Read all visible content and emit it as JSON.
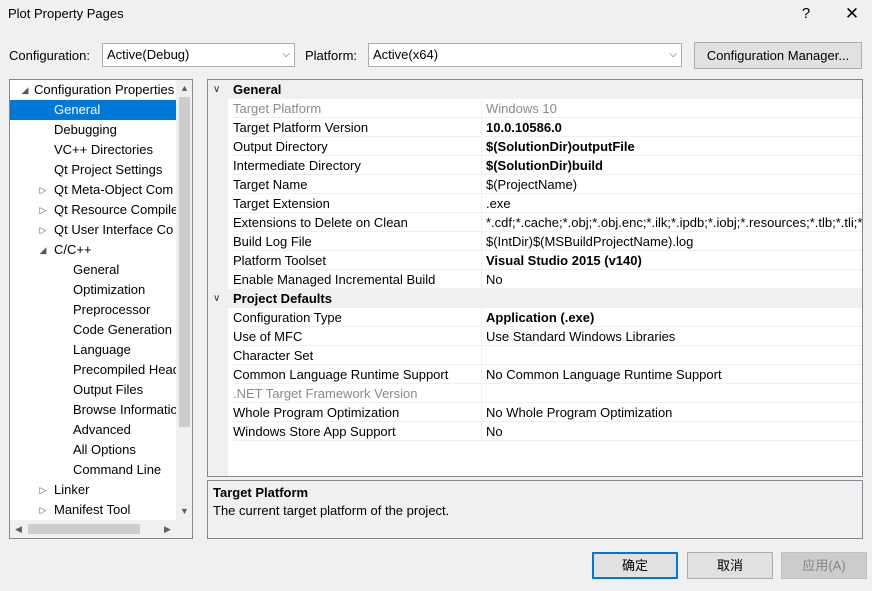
{
  "window": {
    "title": "Plot Property Pages",
    "help_glyph": "?",
    "close_glyph": "✕"
  },
  "toolbar": {
    "configuration_label": "Configuration:",
    "configuration_value": "Active(Debug)",
    "platform_label": "Platform:",
    "platform_value": "Active(x64)",
    "config_manager_label": "Configuration Manager..."
  },
  "tree": {
    "items": [
      {
        "label": "Configuration Properties",
        "level": 0,
        "expander": "expanded"
      },
      {
        "label": "General",
        "level": 1,
        "expander": "none",
        "selected": true
      },
      {
        "label": "Debugging",
        "level": 1,
        "expander": "none"
      },
      {
        "label": "VC++ Directories",
        "level": 1,
        "expander": "none"
      },
      {
        "label": "Qt Project Settings",
        "level": 1,
        "expander": "none"
      },
      {
        "label": "Qt Meta-Object Com",
        "level": 1,
        "expander": "collapsed"
      },
      {
        "label": "Qt Resource Compile",
        "level": 1,
        "expander": "collapsed"
      },
      {
        "label": "Qt User Interface Co",
        "level": 1,
        "expander": "collapsed"
      },
      {
        "label": "C/C++",
        "level": 1,
        "expander": "expanded"
      },
      {
        "label": "General",
        "level": 2,
        "expander": "none"
      },
      {
        "label": "Optimization",
        "level": 2,
        "expander": "none"
      },
      {
        "label": "Preprocessor",
        "level": 2,
        "expander": "none"
      },
      {
        "label": "Code Generation",
        "level": 2,
        "expander": "none"
      },
      {
        "label": "Language",
        "level": 2,
        "expander": "none"
      },
      {
        "label": "Precompiled Head",
        "level": 2,
        "expander": "none"
      },
      {
        "label": "Output Files",
        "level": 2,
        "expander": "none"
      },
      {
        "label": "Browse Informatio",
        "level": 2,
        "expander": "none"
      },
      {
        "label": "Advanced",
        "level": 2,
        "expander": "none"
      },
      {
        "label": "All Options",
        "level": 2,
        "expander": "none"
      },
      {
        "label": "Command Line",
        "level": 2,
        "expander": "none"
      },
      {
        "label": "Linker",
        "level": 1,
        "expander": "collapsed"
      },
      {
        "label": "Manifest Tool",
        "level": 1,
        "expander": "collapsed"
      }
    ]
  },
  "grid": {
    "categories": [
      {
        "name": "General",
        "rows": [
          {
            "name": "Target Platform",
            "value": "Windows 10",
            "bold": false,
            "dim": true
          },
          {
            "name": "Target Platform Version",
            "value": "10.0.10586.0",
            "bold": true,
            "dim": false
          },
          {
            "name": "Output Directory",
            "value": "$(SolutionDir)outputFile",
            "bold": true,
            "dim": false
          },
          {
            "name": "Intermediate Directory",
            "value": "$(SolutionDir)build",
            "bold": true,
            "dim": false
          },
          {
            "name": "Target Name",
            "value": "$(ProjectName)",
            "bold": false,
            "dim": false
          },
          {
            "name": "Target Extension",
            "value": ".exe",
            "bold": false,
            "dim": false
          },
          {
            "name": "Extensions to Delete on Clean",
            "value": "*.cdf;*.cache;*.obj;*.obj.enc;*.ilk;*.ipdb;*.iobj;*.resources;*.tlb;*.tli;*.t",
            "bold": false,
            "dim": false
          },
          {
            "name": "Build Log File",
            "value": "$(IntDir)$(MSBuildProjectName).log",
            "bold": false,
            "dim": false
          },
          {
            "name": "Platform Toolset",
            "value": "Visual Studio 2015 (v140)",
            "bold": true,
            "dim": false
          },
          {
            "name": "Enable Managed Incremental Build",
            "value": "No",
            "bold": false,
            "dim": false
          }
        ]
      },
      {
        "name": "Project Defaults",
        "rows": [
          {
            "name": "Configuration Type",
            "value": "Application (.exe)",
            "bold": true,
            "dim": false
          },
          {
            "name": "Use of MFC",
            "value": "Use Standard Windows Libraries",
            "bold": false,
            "dim": false
          },
          {
            "name": "Character Set",
            "value": "",
            "bold": false,
            "dim": false
          },
          {
            "name": "Common Language Runtime Support",
            "value": "No Common Language Runtime Support",
            "bold": false,
            "dim": false
          },
          {
            "name": ".NET Target Framework Version",
            "value": "",
            "bold": false,
            "dim": true
          },
          {
            "name": "Whole Program Optimization",
            "value": "No Whole Program Optimization",
            "bold": false,
            "dim": false
          },
          {
            "name": "Windows Store App Support",
            "value": "No",
            "bold": false,
            "dim": false
          }
        ]
      }
    ]
  },
  "description": {
    "title": "Target Platform",
    "text": "The current target platform of the project."
  },
  "buttons": {
    "ok": "确定",
    "cancel": "取消",
    "apply": "应用(A)"
  }
}
